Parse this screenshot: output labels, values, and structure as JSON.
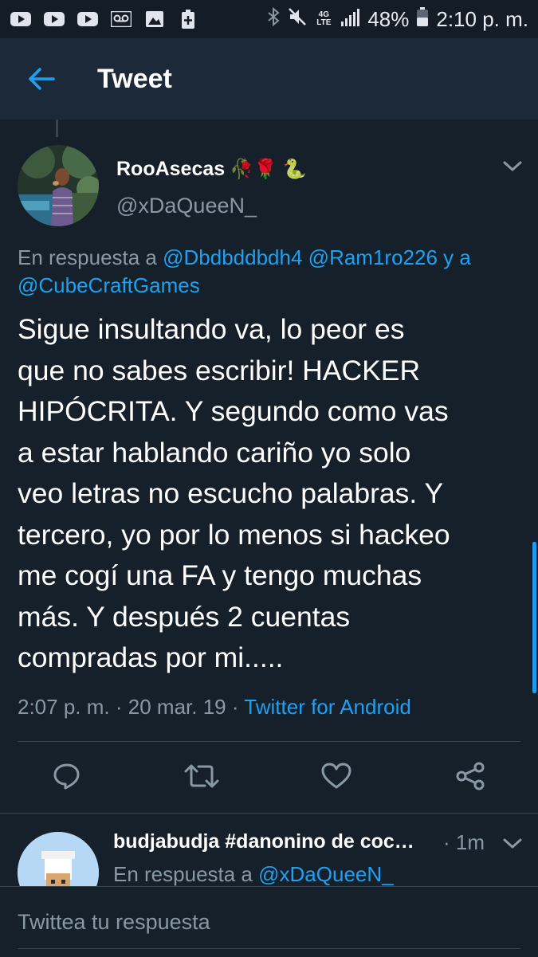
{
  "status_bar": {
    "battery_percent": "48%",
    "time": "2:10 p. m.",
    "network": "4G LTE"
  },
  "app_bar": {
    "title": "Tweet"
  },
  "tweet": {
    "author_name": "RooAsecas",
    "author_emojis": "🥀🌹 🐍",
    "handle": "@xDaQueeN_",
    "reply_prefix": "En respuesta a",
    "reply_mentions": [
      "@Dbdbddbdh4",
      "@Ram1ro226"
    ],
    "reply_joiner": "y a",
    "reply_last": "@CubeCraftGames",
    "text": "Sigue insultando va, lo peor es\nque no sabes escribir! HACKER\nHIPÓCRITA. Y segundo como vas\na estar hablando cariño yo solo\nveo letras no escucho palabras. Y\ntercero, yo por lo menos si hackeo\nme cogí una FA y tengo muchas\nmás. Y después 2 cuentas\ncompradas por mi.....",
    "time": "2:07 p. m.",
    "date": "20 mar. 19",
    "source": "Twitter for Android",
    "separator": "·"
  },
  "reply_tweet": {
    "author_name": "budjabudja #danonino de coc…",
    "time": "· 1m",
    "reply_prefix": "En respuesta a",
    "reply_mention": "@xDaQueeN_"
  },
  "composer": {
    "placeholder": "Twittea tu respuesta"
  },
  "colors": {
    "background": "#15202b",
    "app_bar": "#1c2938",
    "accent": "#1da1f2",
    "secondary_text": "#8899a6",
    "divider": "#38444d"
  },
  "icons": {
    "back": "arrow-left-icon",
    "caret": "chevron-down-icon",
    "reply": "comment-icon",
    "retweet": "retweet-icon",
    "like": "heart-icon",
    "share": "share-icon"
  }
}
